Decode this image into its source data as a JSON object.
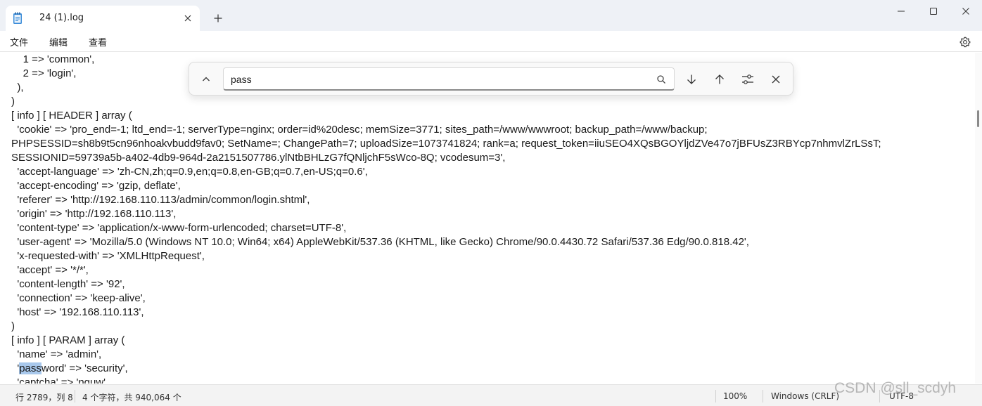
{
  "tab": {
    "title": "24 (1).log"
  },
  "menu": {
    "items": [
      "文件",
      "编辑",
      "查看"
    ]
  },
  "find": {
    "query": "pass"
  },
  "editor": {
    "lines": [
      "    1 => 'common',",
      "    2 => 'login',",
      "  ),",
      ")",
      "[ info ] [ HEADER ] array (",
      "  'cookie' => 'pro_end=-1; ltd_end=-1; serverType=nginx; order=id%20desc; memSize=3771; sites_path=/www/wwwroot; backup_path=/www/backup;",
      "PHPSESSID=sh8b9t5cn96nhoakvbudd9fav0; SetName=; ChangePath=7; uploadSize=1073741824; rank=a; request_token=iiuSEO4XQsBGOYljdZVe47o7jBFUsZ3RBYcp7nhmvlZrLSsT;",
      "SESSIONID=59739a5b-a402-4db9-964d-2a2151507786.ylNtbBHLzG7fQNljchF5sWco-8Q; vcodesum=3',",
      "  'accept-language' => 'zh-CN,zh;q=0.9,en;q=0.8,en-GB;q=0.7,en-US;q=0.6',",
      "  'accept-encoding' => 'gzip, deflate',",
      "  'referer' => 'http://192.168.110.113/admin/common/login.shtml',",
      "  'origin' => 'http://192.168.110.113',",
      "  'content-type' => 'application/x-www-form-urlencoded; charset=UTF-8',",
      "  'user-agent' => 'Mozilla/5.0 (Windows NT 10.0; Win64; x64) AppleWebKit/537.36 (KHTML, like Gecko) Chrome/90.0.4430.72 Safari/537.36 Edg/90.0.818.42',",
      "  'x-requested-with' => 'XMLHttpRequest',",
      "  'accept' => '*/*',",
      "  'content-length' => '92',",
      "  'connection' => 'keep-alive',",
      "  'host' => '192.168.110.113',",
      ")",
      "[ info ] [ PARAM ] array (",
      "  'name' => 'admin',",
      "  'password' => 'security',",
      "  'captcha' => 'nguw',"
    ],
    "highlight": {
      "line": 22,
      "match": "pass"
    }
  },
  "status": {
    "position": "行 2789，列 8",
    "chars": "4 个字符，共 940,064 个",
    "zoom": "100%",
    "line_ending": "Windows (CRLF)",
    "encoding": "UTF-8"
  },
  "watermark": "CSDN @sll_scdyh"
}
